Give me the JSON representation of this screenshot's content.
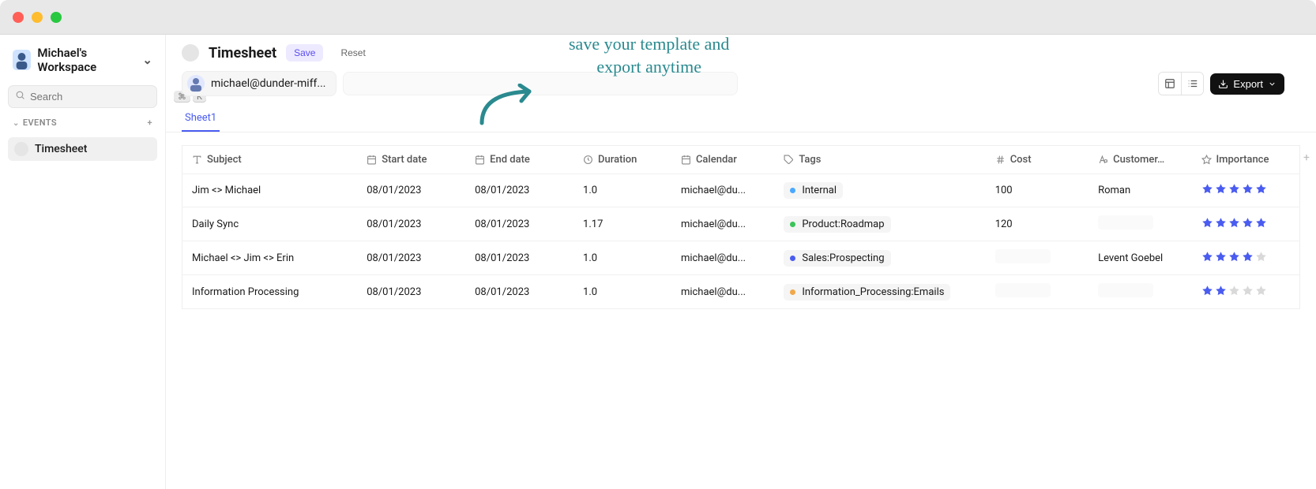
{
  "workspace": {
    "title": "Michael's Workspace"
  },
  "search": {
    "placeholder": "Search",
    "kbd1": "⌘",
    "kbd2": "K"
  },
  "sidebar": {
    "section_label": "EVENTS",
    "items": [
      {
        "label": "Timesheet"
      }
    ]
  },
  "header": {
    "title": "Timesheet",
    "save_label": "Save",
    "reset_label": "Reset"
  },
  "annotation": {
    "line1": "save your template and",
    "line2": "export anytime"
  },
  "chip": {
    "email": "michael@dunder-miff..."
  },
  "toolbox": {
    "export_label": "Export"
  },
  "tabs": [
    {
      "label": "Sheet1"
    }
  ],
  "columns": {
    "subject": "Subject",
    "start_date": "Start date",
    "end_date": "End date",
    "duration": "Duration",
    "calendar": "Calendar",
    "tags": "Tags",
    "cost": "Cost",
    "customer": "Customer…",
    "importance": "Importance"
  },
  "tag_colors": {
    "Internal": "#4aa8ff",
    "Product:Roadmap": "#3cc45a",
    "Sales:Prospecting": "#4a5cf0",
    "Information_Processing:Emails": "#f0a84a"
  },
  "rows": [
    {
      "subject": "Jim <> Michael",
      "start": "08/01/2023",
      "end": "08/01/2023",
      "duration": "1.0",
      "calendar": "michael@du...",
      "tag": "Internal",
      "cost": "100",
      "customer": "Roman",
      "stars": 5
    },
    {
      "subject": "Daily Sync",
      "start": "08/01/2023",
      "end": "08/01/2023",
      "duration": "1.17",
      "calendar": "michael@du...",
      "tag": "Product:Roadmap",
      "cost": "120",
      "customer": "",
      "stars": 5
    },
    {
      "subject": "Michael <> Jim <> Erin",
      "start": "08/01/2023",
      "end": "08/01/2023",
      "duration": "1.0",
      "calendar": "michael@du...",
      "tag": "Sales:Prospecting",
      "cost": "",
      "customer": "Levent Goebel",
      "stars": 4
    },
    {
      "subject": "Information Processing",
      "start": "08/01/2023",
      "end": "08/01/2023",
      "duration": "1.0",
      "calendar": "michael@du...",
      "tag": "Information_Processing:Emails",
      "cost": "",
      "customer": "",
      "stars": 2
    }
  ]
}
